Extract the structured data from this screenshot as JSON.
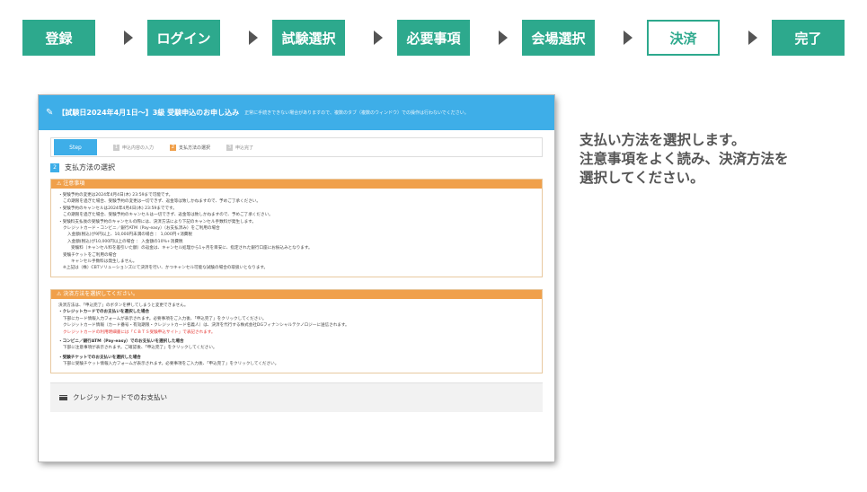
{
  "flow": {
    "steps": [
      "登録",
      "ログイン",
      "試験選択",
      "必要事項",
      "会場選択",
      "決済",
      "完了"
    ],
    "active": "決済"
  },
  "panel": {
    "header_title": "【試験日2024年4月1日〜】3級 受験申込のお申し込み",
    "header_note": "正常に手続きできない場合がありますので、複数のタブ（複数のウィンドウ）での操作は行わないでください。",
    "steps": {
      "current_label": "Step",
      "items": [
        {
          "num": "1",
          "label": "申込内容の入力"
        },
        {
          "num": "2",
          "label": "支払方法の選択"
        },
        {
          "num": "3",
          "label": "申込完了"
        }
      ]
    },
    "section_num": "2",
    "section_title": "支払方法の選択",
    "notice": {
      "title": "注意事項",
      "lines": [
        "・受験予約の変更は2024年4月4日(木) 23:59まで可能です。",
        "この期限を過ぎた場合、受験予約の変更は一切できず、返金等は致しかねますので、予めご了承ください。",
        "・受験予約のキャンセルは2024年4月4日(木) 23:59までです。",
        "この期限を過ぎた場合、受験予約のキャンセルは一切できず、返金等は致しかねますので、予めご了承ください。",
        "・受験料支払後の受験予約のキャンセルの際には、決済方法により下記のキャンセル手数料が発生します。",
        "クレジットカード・コンビニ／銀行ATM（Pay-easy）（お支払済み）をご利用の場合",
        "入金額(税込)が9円以上、10,000円未満の場合 ： 1,000円+消費税",
        "入金額(税込)が10,000円以上の場合 ： 入金額の10%+消費税",
        "受験料（キャンセル料を差引いた額）の返金は、キャンセル処理から1ヶ月を目安に、指定された銀行口座にお振込みとなります。",
        "受験チケットをご利用の場合",
        "キャンセル手数料は発生しません。",
        "※上記は（株）CBTソリューションズにて決済を行い、かつキャンセル可能な試験の場合の取扱いとなります。"
      ]
    },
    "method": {
      "title": "決済方法を選択してください。",
      "intro": "決済方法は、「申込完了」のボタンを押してしまうと変更できません。",
      "credit_head": "クレジットカードでのお支払いを選択した場合",
      "credit_l1": "下部にカード情報入力フォームが表示されます。必要事項をご入力後、「申込完了」をクリックしてください。",
      "credit_l2": "クレジットカード情報（カード番号・有効期限・クレジットカード名義人）は、決済を代行する株式会社DGフィナンシャルテクノロジーに送信されます。",
      "credit_red": "クレジットカードの利用明細書には「ＣＢＴＳ受験申込サイト」で表記されます。",
      "conv_head": "コンビニ／銀行ATM（Pay-easy）でのお支払いを選択した場合",
      "conv_l1": "下部に注意事項が表示されます。ご確認後、「申込完了」をクリックしてください。",
      "ticket_head": "受験チケットでのお支払いを選択した場合",
      "ticket_l1": "下部に受験チケット情報入力フォームが表示されます。必要事項をご入力後、「申込完了」をクリックしてください。"
    },
    "credit_section_title": "クレジットカードでのお支払い"
  },
  "description": [
    "支払い方法を選択します。",
    "注意事項をよく読み、決済方法を",
    "選択してください。"
  ],
  "colors": {
    "flow_green": "#2da98d",
    "header_blue": "#3eaee8",
    "notice_orange": "#f0a04b",
    "warning_red": "#e53935"
  }
}
